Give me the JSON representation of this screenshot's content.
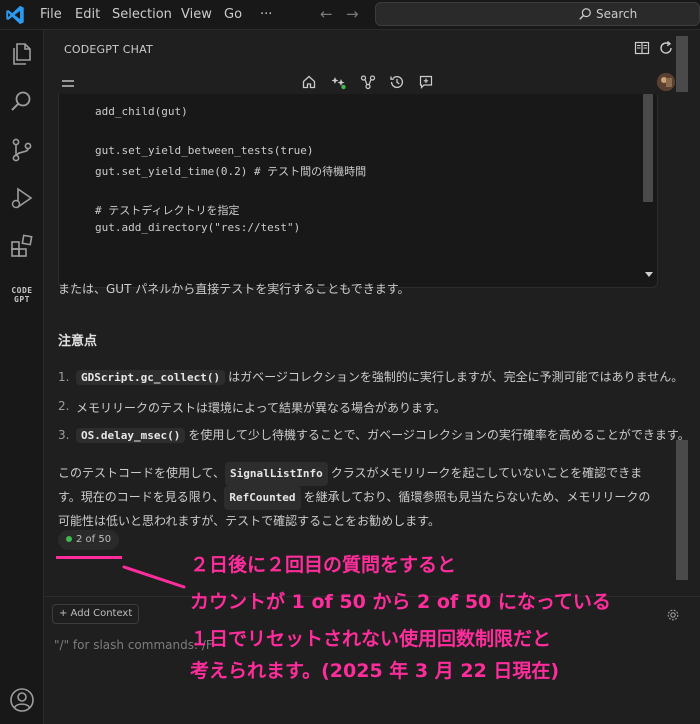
{
  "menu": {
    "items": [
      "File",
      "Edit",
      "Selection",
      "View",
      "Go",
      "···"
    ]
  },
  "search": {
    "label": "Search"
  },
  "panel": {
    "title": "CODEGPT CHAT"
  },
  "code": {
    "lines": [
      "add_child(gut)",
      "",
      "gut.set_yield_between_tests(true)",
      "gut.set_yield_time(0.2) # テスト間の待機時間",
      "",
      "# テストディレクトリを指定",
      "gut.add_directory(\"res://test\")"
    ]
  },
  "chat": {
    "intro": "または、GUT パネルから直接テストを実行することもできます。",
    "notes_heading": "注意点",
    "notes": [
      {
        "num": "1.",
        "code": "GDScript.gc_collect()",
        "text": "はガベージコレクションを強制的に実行しますが、完全に予測可能ではありません。"
      },
      {
        "num": "2.",
        "code": "",
        "text": "メモリリークのテストは環境によって結果が異なる場合があります。"
      },
      {
        "num": "3.",
        "code": "OS.delay_msec()",
        "text": "を使用して少し待機することで、ガベージコレクションの実行確率を高めることができます。"
      }
    ],
    "summary_a": "このテストコードを使用して、",
    "summary_code1": "SignalListInfo",
    "summary_b": "クラスがメモリリークを起こしていないことを確認できます。現在のコードを見る限り、",
    "summary_code2": "RefCounted",
    "summary_c": "を継承しており、循環参照も見当たらないため、メモリリークの可能性は低いと思われますが、テストで確認することをお勧めします。",
    "counter": "2 of 50"
  },
  "input": {
    "add_context": "+ Add Context",
    "placeholder": "\"/\" for slash commands: /F"
  },
  "activity": {
    "codegpt_logo_top": "CODE",
    "codegpt_logo_bottom": "GPT"
  },
  "annotation": {
    "line1": "２日後に２回目の質問をすると",
    "line2": "カウントが 1 of 50 から 2 of 50 になっている",
    "line3": "１日でリセットされない使用回数制限だと",
    "line4": "考えられます。(2025 年 3 月 22 日現在)"
  },
  "colors": {
    "accent": "#0078d4",
    "annotation": "#ff2d9b",
    "status_dot": "#3fb950",
    "background": "#1f1f1f"
  }
}
